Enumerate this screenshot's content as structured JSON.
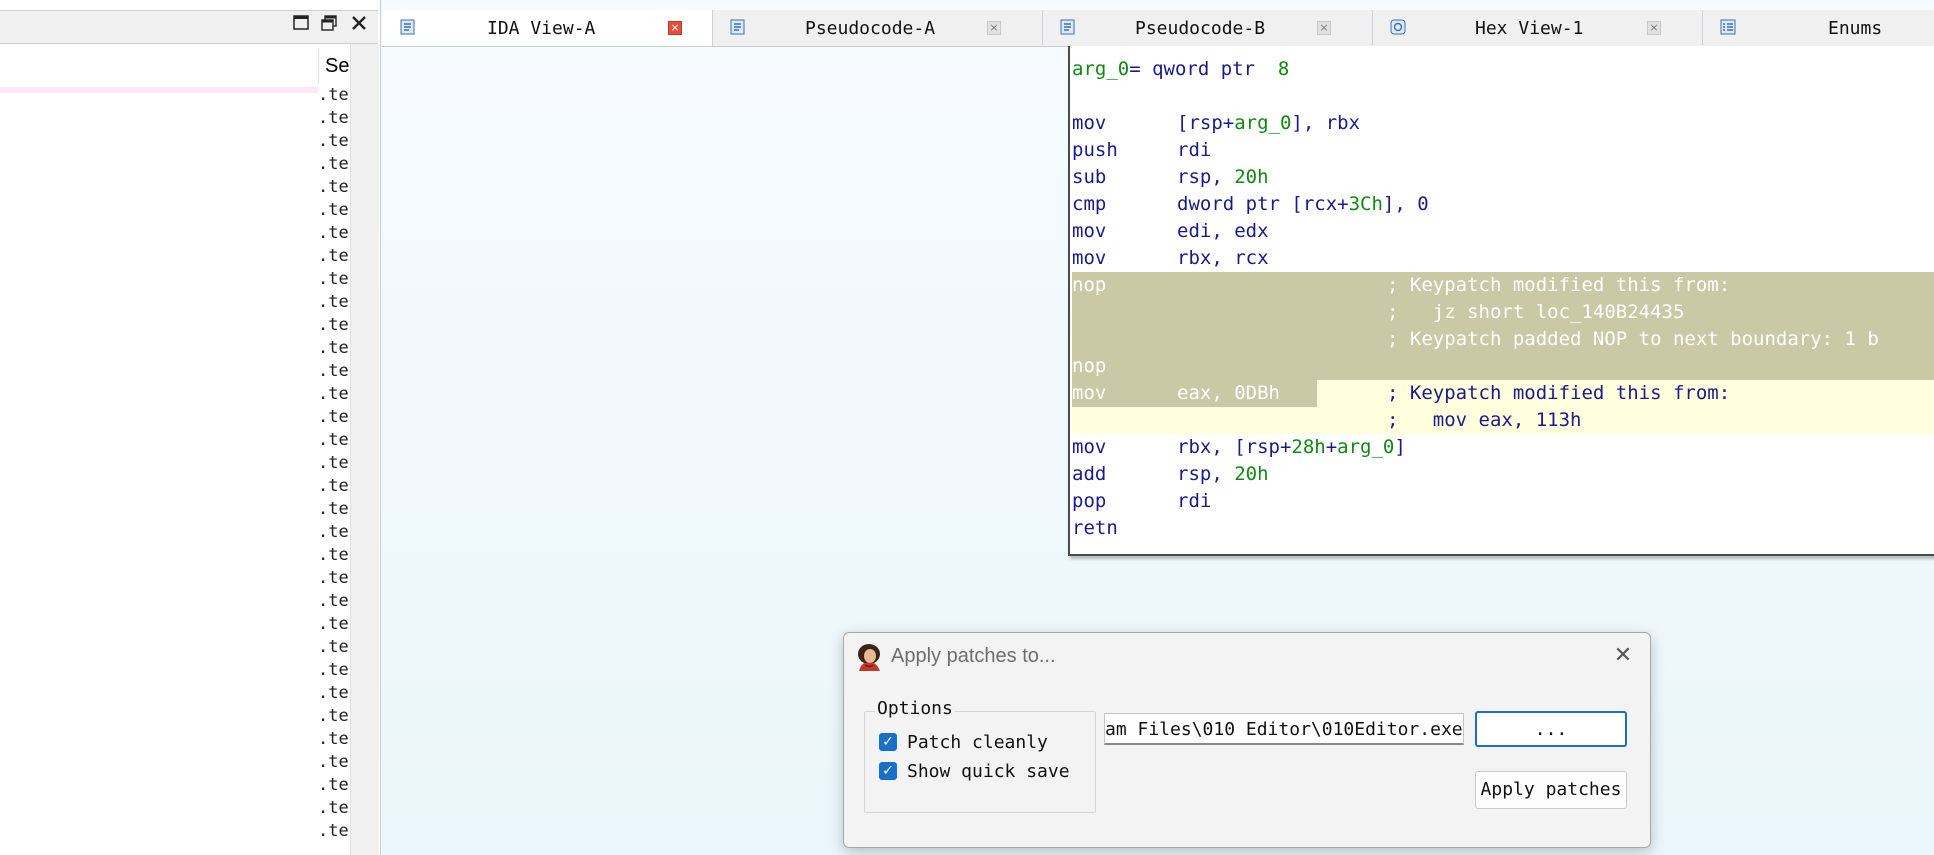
{
  "left_panel": {
    "column_header": "Se",
    "segment_items": [
      ".te",
      ".te",
      ".te",
      ".te",
      ".te",
      ".te",
      ".te",
      ".te",
      ".te",
      ".te",
      ".te",
      ".te",
      ".te",
      ".te",
      ".te",
      ".te",
      ".te",
      ".te",
      ".te",
      ".te",
      ".te",
      ".te",
      ".te",
      ".te",
      ".te",
      ".te",
      ".te",
      ".te",
      ".te",
      ".te",
      ".te",
      ".te",
      ".te"
    ]
  },
  "titlebar_icons": [
    "maximize-icon",
    "restore-icon",
    "close-icon"
  ],
  "tabs": [
    {
      "label": "IDA View-A",
      "active": true
    },
    {
      "label": "Pseudocode-A",
      "active": false
    },
    {
      "label": "Pseudocode-B",
      "active": false
    },
    {
      "label": "Hex View-1",
      "active": false
    },
    {
      "label": "Enums",
      "active": false
    }
  ],
  "disassembly": {
    "header": {
      "name": "arg_0",
      "rest": "= qword ptr  ",
      "value": "8"
    },
    "lines": [
      {
        "mnemonic": "mov",
        "operand_parts": [
          {
            "t": "[rsp+",
            "c": "n"
          },
          {
            "t": "arg_0",
            "c": "g"
          },
          {
            "t": "], rbx",
            "c": "n"
          }
        ]
      },
      {
        "mnemonic": "push",
        "operand_parts": [
          {
            "t": "rdi",
            "c": "n"
          }
        ]
      },
      {
        "mnemonic": "sub",
        "operand_parts": [
          {
            "t": "rsp, ",
            "c": "n"
          },
          {
            "t": "20h",
            "c": "g"
          }
        ]
      },
      {
        "mnemonic": "cmp",
        "operand_parts": [
          {
            "t": "dword ptr [rcx+",
            "c": "n"
          },
          {
            "t": "3Ch",
            "c": "g"
          },
          {
            "t": "], 0",
            "c": "n"
          }
        ]
      },
      {
        "mnemonic": "mov",
        "operand_parts": [
          {
            "t": "edi, edx",
            "c": "n"
          }
        ]
      },
      {
        "mnemonic": "mov",
        "operand_parts": [
          {
            "t": "rbx, rcx",
            "c": "n"
          }
        ]
      }
    ],
    "patched_lines": [
      {
        "mnemonic": "nop",
        "comment": "; Keypatch modified this from:"
      },
      {
        "mnemonic": "",
        "comment": ";   jz short loc_140B24435"
      },
      {
        "mnemonic": "",
        "comment": "; Keypatch padded NOP to next boundary: 1 b"
      },
      {
        "mnemonic": "nop",
        "comment": ""
      }
    ],
    "yellow_lines": [
      {
        "mnemonic": "mov",
        "operand": "eax, 0DBh",
        "comment": "; Keypatch modified this from:"
      },
      {
        "mnemonic": "",
        "operand": "",
        "comment": ";   mov eax, 113h"
      }
    ],
    "tail_lines": [
      {
        "mnemonic": "mov",
        "operand_parts": [
          {
            "t": "rbx, [rsp+",
            "c": "n"
          },
          {
            "t": "28h",
            "c": "g"
          },
          {
            "t": "+",
            "c": "n"
          },
          {
            "t": "arg_0",
            "c": "g"
          },
          {
            "t": "]",
            "c": "n"
          }
        ]
      },
      {
        "mnemonic": "add",
        "operand_parts": [
          {
            "t": "rsp, ",
            "c": "n"
          },
          {
            "t": "20h",
            "c": "g"
          }
        ]
      },
      {
        "mnemonic": "pop",
        "operand_parts": [
          {
            "t": "rdi",
            "c": "n"
          }
        ]
      },
      {
        "mnemonic": "retn",
        "operand_parts": []
      }
    ]
  },
  "dialog": {
    "title": "Apply patches to...",
    "options_legend": "Options",
    "options": [
      {
        "label": "Patch cleanly",
        "checked": true
      },
      {
        "label": "Show quick save",
        "checked": true
      }
    ],
    "path_value": "am Files\\010 Editor\\010Editor.exe",
    "browse_label": "...",
    "apply_label": "Apply patches"
  },
  "colors": {
    "accent": "#1a6fc9",
    "patched_bg": "#c9c9a6",
    "yellow_bg": "#ffffdd",
    "asm_text": "#1a1a8c",
    "asm_number": "#118811",
    "tab_close_active": "#e74c3c"
  }
}
